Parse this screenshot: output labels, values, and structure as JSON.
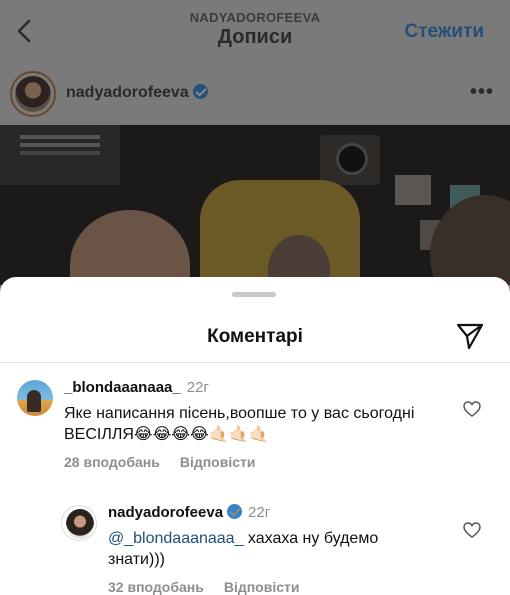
{
  "nav": {
    "back_icon": "chevron-left-icon",
    "subtitle": "NADYADOROFEEVA",
    "title": "Дописи",
    "follow_label": "Стежити"
  },
  "post": {
    "username": "nadyadorofeeva",
    "verified_icon": "verified-badge-icon",
    "more_icon": "more-horizontal-icon",
    "more_label": "•••"
  },
  "sheet": {
    "title": "Коментарі",
    "share_icon": "paper-plane-icon"
  },
  "comments": [
    {
      "username": "_blondaaanaaa_",
      "time": "22г",
      "text": "Яке написання пісень,воопше то у вас сьогодні ВЕСІЛЛЯ😂😂😂😂🤙🏻🤙🏻🤙🏻",
      "likes": "28 вподобань",
      "reply_label": "Відповісти",
      "like_icon": "heart-outline-icon"
    },
    {
      "username": "nadyadorofeeva",
      "time": "22г",
      "mention": "@_blondaaanaaa_",
      "text": " хахаха ну будемо знати)))",
      "likes": "32 вподобань",
      "reply_label": "Відповісти",
      "like_icon": "heart-outline-icon"
    }
  ],
  "colors": {
    "accent": "#234f78",
    "mention": "#1f4f7a",
    "muted": "#8e8e8e"
  }
}
